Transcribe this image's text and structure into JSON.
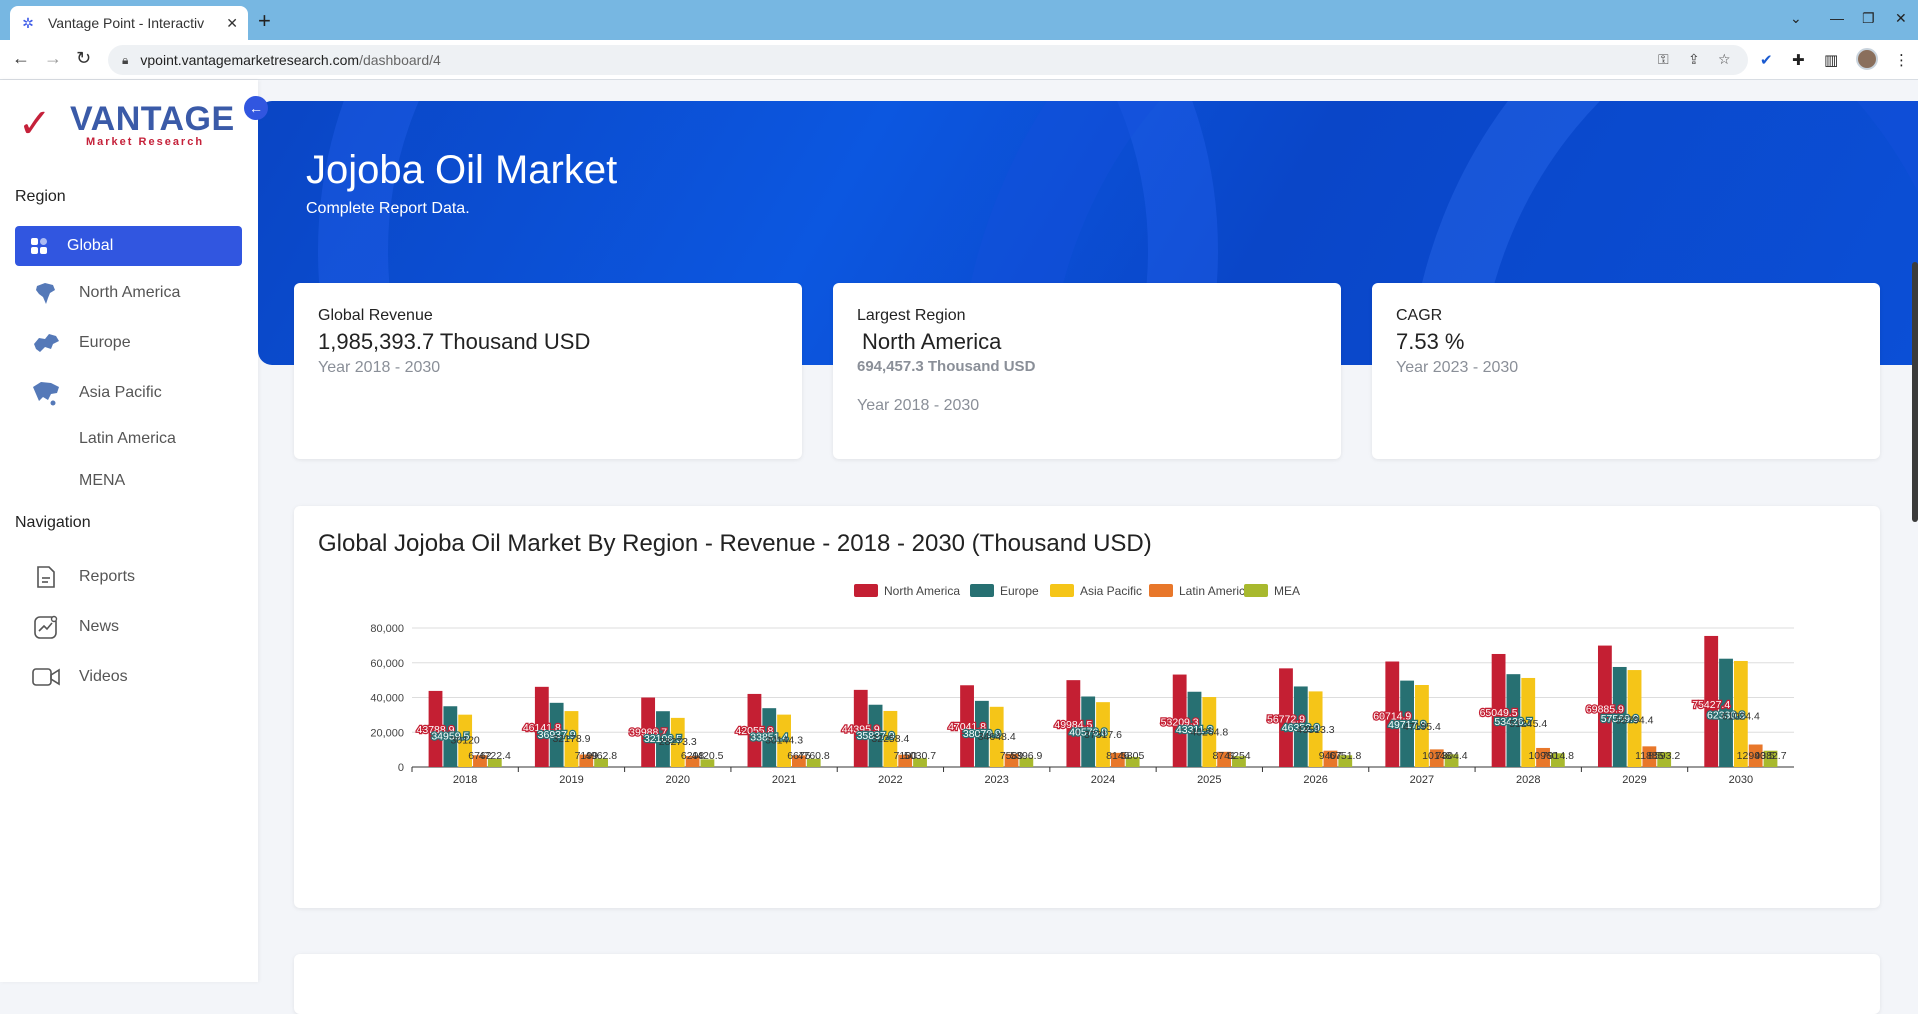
{
  "browser": {
    "tab_title": "Vantage Point - Interactiv",
    "url_host": "vpoint.vantagemarketresearch.com",
    "url_path": "/dashboard/4"
  },
  "logo": {
    "word": "VANTAGE",
    "sub": "Market Research"
  },
  "sidebar": {
    "region_heading": "Region",
    "regions": [
      {
        "label": "Global",
        "icon": "grid-icon",
        "active": true
      },
      {
        "label": "North America",
        "icon": "north-america-map-icon"
      },
      {
        "label": "Europe",
        "icon": "europe-map-icon"
      },
      {
        "label": "Asia Pacific",
        "icon": "asia-pacific-map-icon"
      },
      {
        "label": "Latin America",
        "icon": ""
      },
      {
        "label": "MENA",
        "icon": ""
      }
    ],
    "nav_heading": "Navigation",
    "nav": [
      {
        "label": "Reports",
        "icon": "document-icon"
      },
      {
        "label": "News",
        "icon": "chart-line-icon"
      },
      {
        "label": "Videos",
        "icon": "video-icon"
      }
    ]
  },
  "hero": {
    "title": "Jojoba Oil Market",
    "subtitle": "Complete Report Data."
  },
  "cards": [
    {
      "label": "Global Revenue",
      "value": "1,985,393.7 Thousand USD",
      "note": "Year 2018 - 2030"
    },
    {
      "label": "Largest Region",
      "value": "North America",
      "sub_value": "694,457.3 Thousand USD",
      "note": "Year 2018 - 2030"
    },
    {
      "label": "CAGR",
      "value": "7.53 %",
      "note": "Year 2023 - 2030"
    }
  ],
  "chart_title": "Global Jojoba Oil Market By Region - Revenue - 2018 - 2030 (Thousand USD)",
  "colors": {
    "accent": "#3156e0",
    "north_america": "#c41f33",
    "europe": "#277072",
    "asia_pacific": "#f5c518",
    "latin_america": "#e8772a",
    "mea": "#a8b92e"
  },
  "chart_data": {
    "type": "bar",
    "title": "Global Jojoba Oil Market By Region - Revenue - 2018 - 2030 (Thousand USD)",
    "categories": [
      "2018",
      "2019",
      "2020",
      "2021",
      "2022",
      "2023",
      "2024",
      "2025",
      "2026",
      "2027",
      "2028",
      "2029",
      "2030"
    ],
    "ylim": [
      0,
      80000
    ],
    "yticks": [
      "0",
      "20,000",
      "40,000",
      "60,000",
      "80,000"
    ],
    "legend": "top-center",
    "grid": true,
    "series": [
      {
        "name": "North America",
        "values": [
          43788.9,
          46141.8,
          39988.7,
          42055.8,
          44395.9,
          47041.8,
          49984.5,
          53209.3,
          56772.9,
          60714.9,
          65049.5,
          69885.9,
          75427.4
        ],
        "labels": [
          "43788.9",
          "46141.8",
          "39988.7",
          "42055.8",
          "44395.9",
          "47041.8",
          "49984.5",
          "53209.3",
          "56772.9",
          "60714.9",
          "65049.5",
          "69885.9",
          "75427.4"
        ]
      },
      {
        "name": "Europe",
        "values": [
          34959.5,
          36937.9,
          32106.5,
          33851.4,
          35837.9,
          38070.9,
          40576.8,
          43311.3,
          46352.9,
          49717.8,
          53426.7,
          57569.9,
          62330.3
        ],
        "labels": [
          "34959.5",
          "36937.9",
          "32106.5",
          "33851.4",
          "35837.9",
          "38070.9",
          "40576.8",
          "43311.3",
          "46352.9",
          "49717.8",
          "53426.7",
          "57569.9",
          "62330.3"
        ]
      },
      {
        "name": "Asia Pacific",
        "values": [
          30120,
          32178.9,
          28273.3,
          30144.3,
          32258.4,
          34648.4,
          37317.6,
          40264.8,
          43513.3,
          47195.4,
          51245.4,
          55794.4,
          61024.4
        ],
        "labels": [
          "30120",
          "32178.9",
          "28273.3",
          "30144.3",
          "32258.4",
          "34648.4",
          "37317.6",
          "40264.8",
          "43513.3",
          "47195.4",
          "51245.4",
          "55794.4",
          "61024.4"
        ]
      },
      {
        "name": "Latin America",
        "values": [
          6762,
          7199,
          6298,
          6675,
          7100,
          7589,
          8146,
          8741,
          9407,
          10148,
          10960,
          11885,
          12940.5
        ],
        "labels": [
          "6762",
          "7199",
          "6298",
          "6675",
          "7100",
          "7589",
          "8146",
          "8741",
          "9407",
          "10148",
          "10960",
          "11885",
          "12940.5"
        ]
      },
      {
        "name": "MEA",
        "values": [
          4722.4,
          4962.8,
          4420.5,
          4760.8,
          5030.7,
          5396.9,
          5805,
          6254,
          6751.8,
          7304.4,
          7914.8,
          8593.2,
          9382.7
        ],
        "labels": [
          "4722.4",
          "4962.8",
          "4420.5",
          "4760.8",
          "5030.7",
          "5396.9",
          "5805",
          "6254",
          "6751.8",
          "7304.4",
          "7914.8",
          "8593.2",
          "9382.7"
        ]
      }
    ]
  }
}
